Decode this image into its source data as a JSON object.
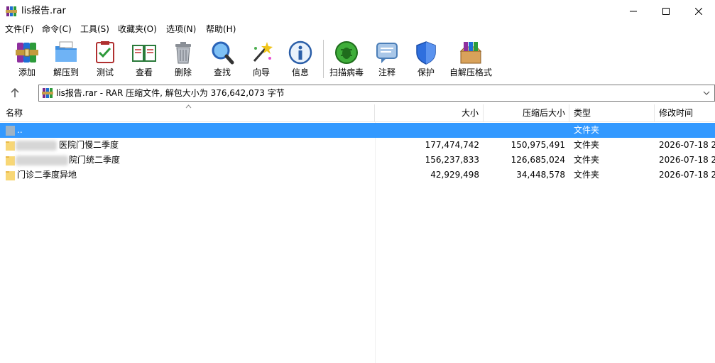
{
  "window": {
    "title": "lis报告.rar",
    "controls": [
      "minimize",
      "maximize",
      "close"
    ]
  },
  "menu": [
    {
      "label": "文件(F)"
    },
    {
      "label": "命令(C)"
    },
    {
      "label": "工具(S)"
    },
    {
      "label": "收藏夹(O)"
    },
    {
      "label": "选项(N)"
    },
    {
      "label": "帮助(H)"
    }
  ],
  "toolbar": [
    {
      "label": "添加",
      "icon": "add-archive-icon"
    },
    {
      "label": "解压到",
      "icon": "extract-to-icon"
    },
    {
      "label": "测试",
      "icon": "test-icon"
    },
    {
      "label": "查看",
      "icon": "view-book-icon"
    },
    {
      "label": "删除",
      "icon": "trash-icon"
    },
    {
      "label": "查找",
      "icon": "magnifier-icon"
    },
    {
      "label": "向导",
      "icon": "wizard-icon"
    },
    {
      "label": "信息",
      "icon": "info-icon"
    },
    {
      "label": "扫描病毒",
      "icon": "virus-scan-icon"
    },
    {
      "label": "注释",
      "icon": "comment-icon"
    },
    {
      "label": "保护",
      "icon": "shield-icon"
    },
    {
      "label": "自解压格式",
      "icon": "sfx-box-icon"
    }
  ],
  "address": {
    "text": "lis报告.rar - RAR 压缩文件, 解包大小为 376,642,073 字节"
  },
  "columns": {
    "name": "名称",
    "size": "大小",
    "packed": "压缩后大小",
    "type": "类型",
    "modified": "修改时间"
  },
  "rows": [
    {
      "name": "..",
      "size": "",
      "packed": "",
      "type": "文件夹",
      "modified": ""
    },
    {
      "name": "医院门慢二季度",
      "size": "177,474,742",
      "packed": "150,975,491",
      "type": "文件夹",
      "modified": "2026-07-18 2"
    },
    {
      "name": "院门统二季度",
      "size": "156,237,833",
      "packed": "126,685,024",
      "type": "文件夹",
      "modified": "2026-07-18 2"
    },
    {
      "name": "门诊二季度异地",
      "size": "42,929,498",
      "packed": "34,448,578",
      "type": "文件夹",
      "modified": "2026-07-18 2"
    }
  ],
  "colors": {
    "selection": "#3399ff",
    "folder": "#f8d775",
    "accent": "#2e7d32"
  }
}
